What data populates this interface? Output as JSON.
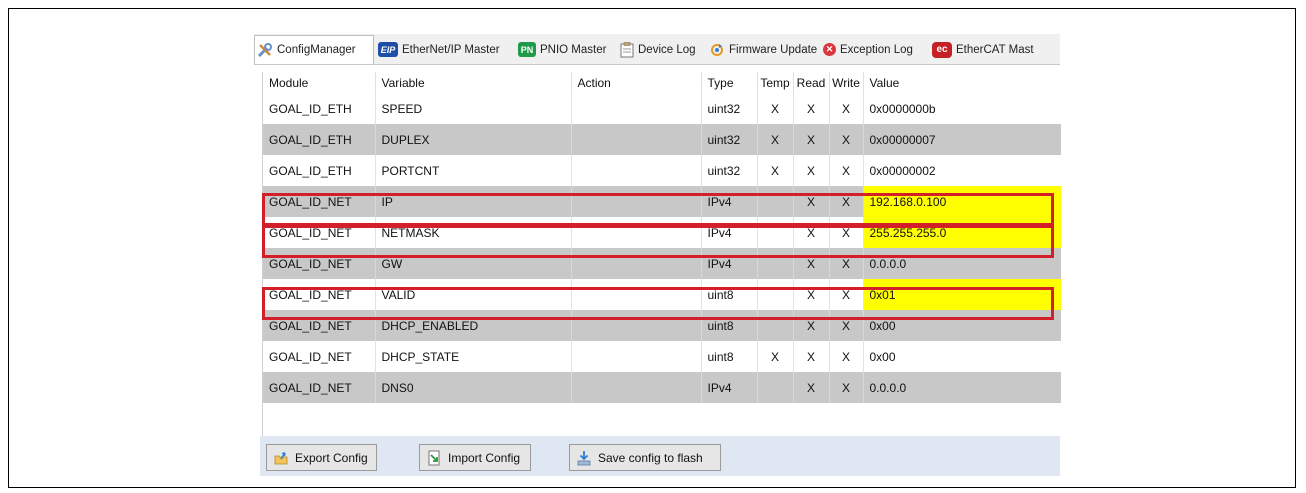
{
  "tabs": [
    {
      "label": "ConfigManager",
      "icon": "tools-icon"
    },
    {
      "label": "EtherNet/IP Master",
      "icon": "eip-icon",
      "badge": "EIP"
    },
    {
      "label": "PNIO Master",
      "icon": "pnio-icon",
      "badge": "PN"
    },
    {
      "label": "Device Log",
      "icon": "clipboard-icon"
    },
    {
      "label": "Firmware Update",
      "icon": "update-icon"
    },
    {
      "label": "Exception Log",
      "icon": "error-icon"
    },
    {
      "label": "EtherCAT Mast",
      "icon": "ethercat-icon",
      "badge": "ec"
    }
  ],
  "columns": [
    "Module",
    "Variable",
    "Action",
    "Type",
    "Temp",
    "Read",
    "Write",
    "Value"
  ],
  "rows": [
    {
      "module": "GOAL_ID_ETH",
      "variable": "SPEED",
      "action": "",
      "type": "uint32",
      "temp": "X",
      "read": "X",
      "write": "X",
      "value": "0x0000000b"
    },
    {
      "module": "GOAL_ID_ETH",
      "variable": "DUPLEX",
      "action": "",
      "type": "uint32",
      "temp": "X",
      "read": "X",
      "write": "X",
      "value": "0x00000007"
    },
    {
      "module": "GOAL_ID_ETH",
      "variable": "PORTCNT",
      "action": "",
      "type": "uint32",
      "temp": "X",
      "read": "X",
      "write": "X",
      "value": "0x00000002"
    },
    {
      "module": "GOAL_ID_NET",
      "variable": "IP",
      "action": "",
      "type": "IPv4",
      "temp": "",
      "read": "X",
      "write": "X",
      "value": "192.168.0.100"
    },
    {
      "module": "GOAL_ID_NET",
      "variable": "NETMASK",
      "action": "",
      "type": "IPv4",
      "temp": "",
      "read": "X",
      "write": "X",
      "value": "255.255.255.0"
    },
    {
      "module": "GOAL_ID_NET",
      "variable": "GW",
      "action": "",
      "type": "IPv4",
      "temp": "",
      "read": "X",
      "write": "X",
      "value": "0.0.0.0"
    },
    {
      "module": "GOAL_ID_NET",
      "variable": "VALID",
      "action": "",
      "type": "uint8",
      "temp": "",
      "read": "X",
      "write": "X",
      "value": "0x01"
    },
    {
      "module": "GOAL_ID_NET",
      "variable": "DHCP_ENABLED",
      "action": "",
      "type": "uint8",
      "temp": "",
      "read": "X",
      "write": "X",
      "value": "0x00"
    },
    {
      "module": "GOAL_ID_NET",
      "variable": "DHCP_STATE",
      "action": "",
      "type": "uint8",
      "temp": "X",
      "read": "X",
      "write": "X",
      "value": "0x00"
    },
    {
      "module": "GOAL_ID_NET",
      "variable": "DNS0",
      "action": "",
      "type": "IPv4",
      "temp": "",
      "read": "X",
      "write": "X",
      "value": "0.0.0.0"
    }
  ],
  "highlight_color": "#ffff00",
  "callout_color": "#d21f2a",
  "buttons": {
    "export": "Export Config",
    "import": "Import Config",
    "save": "Save config to flash"
  }
}
